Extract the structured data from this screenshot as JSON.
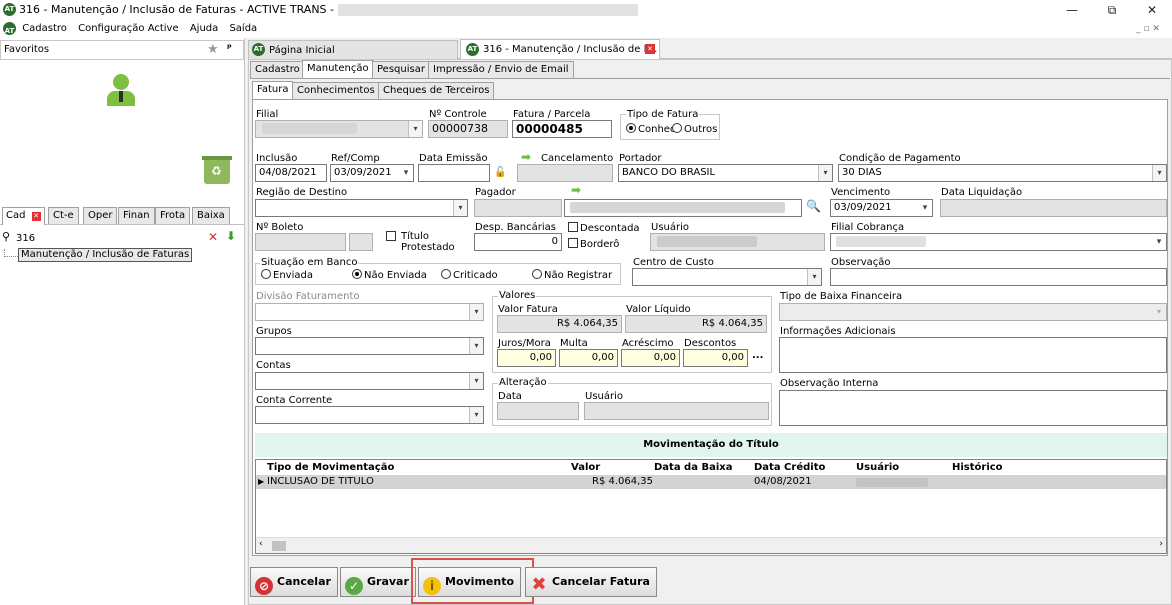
{
  "window": {
    "title": "316 - Manutenção / Inclusão de Faturas - ACTIVE TRANS - EMPRESA:",
    "app_icon": "AT",
    "minimize": "—",
    "restore": "⧉",
    "close": "✕"
  },
  "menu": [
    "Cadastro",
    "Configuração Active",
    "Ajuda",
    "Saída"
  ],
  "mdi_controls": "_ ▫ ✕",
  "left": {
    "favorites_label": "Favoritos",
    "bottom_tabs": [
      "Cad",
      "Ct-e",
      "Oper",
      "Finan",
      "Frota",
      "Baixa"
    ],
    "search_value": "316",
    "tree_item": "Manutenção / Inclusão de Faturas"
  },
  "doc_tabs": [
    "Página Inicial",
    "316 - Manutenção / Inclusão de F..."
  ],
  "main_tabs": [
    "Cadastro",
    "Manutenção",
    "Pesquisar",
    "Impressão / Envio de Email"
  ],
  "sub_tabs": [
    "Fatura",
    "Conhecimentos",
    "Cheques de Terceiros"
  ],
  "form": {
    "filial_label": "Filial",
    "nro_controle_label": "Nº Controle",
    "nro_controle": "00000738",
    "fatura_parcela_label": "Fatura / Parcela",
    "fatura_parcela": "00000485",
    "tipo_fatura_label": "Tipo de Fatura",
    "tipo_conhec": "Conhec",
    "tipo_outros": "Outros",
    "inclusao_label": "Inclusão",
    "inclusao": "04/08/2021",
    "refcomp_label": "Ref/Comp",
    "refcomp": "03/09/2021",
    "data_emissao_label": "Data Emissão",
    "cancelamento_label": "Cancelamento",
    "portador_label": "Portador",
    "portador": "BANCO DO BRASIL",
    "cond_pag_label": "Condição de Pagamento",
    "cond_pag": "30 DIAS",
    "regiao_label": "Região de Destino",
    "pagador_label": "Pagador",
    "vencimento_label": "Vencimento",
    "vencimento": "03/09/2021",
    "data_liq_label": "Data Liquidação",
    "boleto_label": "Nº Boleto",
    "titulo_protestado": "Título Protestado",
    "desp_label": "Desp. Bancárias",
    "desp": "0",
    "descontada": "Descontada",
    "bordero": "Borderô",
    "usuario_label": "Usuário",
    "filial_cobranca_label": "Filial Cobrança",
    "situacao_label": "Situação em Banco",
    "sit_enviada": "Enviada",
    "sit_nao_enviada": "Não Enviada",
    "sit_criticado": "Criticado",
    "sit_nao_registrar": "Não Registrar",
    "centro_custo_label": "Centro de Custo",
    "observacao_label": "Observação",
    "divisao_label": "Divisão Faturamento",
    "grupos_label": "Grupos",
    "contas_label": "Contas",
    "conta_corrente_label": "Conta Corrente",
    "valores_label": "Valores",
    "valor_fatura_label": "Valor Fatura",
    "valor_fatura": "R$ 4.064,35",
    "valor_liquido_label": "Valor Líquido",
    "valor_liquido": "R$ 4.064,35",
    "juros_label": "Juros/Mora",
    "juros": "0,00",
    "multa_label": "Multa",
    "multa": "0,00",
    "acrescimo_label": "Acréscimo",
    "acrescimo": "0,00",
    "descontos_label": "Descontos",
    "descontos": "0,00",
    "more_btn": "...",
    "alteracao_label": "Alteração",
    "alt_data_label": "Data",
    "alt_usuario_label": "Usuário",
    "tipo_baixa_label": "Tipo de Baixa Financeira",
    "info_adic_label": "Informações Adicionais",
    "obs_interna_label": "Observação Interna"
  },
  "movimentacao": {
    "title": "Movimentação do Título",
    "columns": [
      "Tipo de Movimentação",
      "Valor",
      "Data da Baixa",
      "Data Crédito",
      "Usuário",
      "Histórico"
    ],
    "row": {
      "tipo": "INCLUSAO DE TITULO",
      "valor": "R$ 4.064,35",
      "data_baixa": "",
      "data_credito": "04/08/2021"
    }
  },
  "buttons": {
    "cancelar": "Cancelar",
    "gravar": "Gravar",
    "movimento": "Movimento",
    "cancelar_fatura": "Cancelar Fatura"
  },
  "colors": {
    "highlight": "#d9534f",
    "mov_header": "#e0f5ec",
    "arrow": "#6cbf3c"
  }
}
